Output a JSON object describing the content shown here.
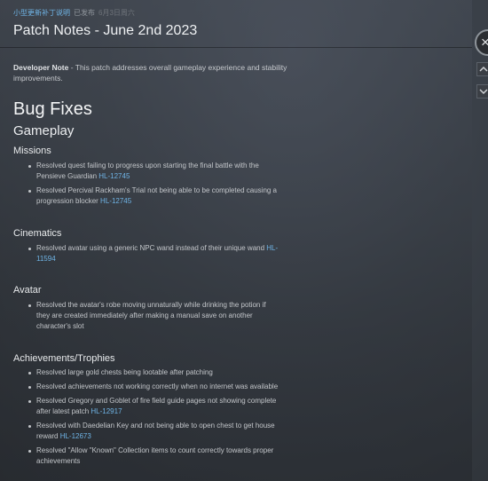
{
  "header": {
    "tag": "小型更新补丁说明",
    "posted": "已发布",
    "date": "6月3日周六",
    "title": "Patch Notes - June 2nd 2023"
  },
  "developer_note": {
    "label": "Developer Note",
    "text": " - This patch addresses overall gameplay experience and stability improvements."
  },
  "bug_fixes_heading": "Bug Fixes",
  "gameplay_heading": "Gameplay",
  "sections": {
    "missions": {
      "heading": "Missions",
      "items": [
        {
          "text": "Resolved quest failing to progress upon starting the final battle with the Pensieve Guardian ",
          "link": "HL-12745"
        },
        {
          "text": "Resolved Percival Rackham's Trial not being able to be completed causing a progression blocker ",
          "link": "HL-12745"
        }
      ]
    },
    "cinematics": {
      "heading": "Cinematics",
      "items": [
        {
          "text": "Resolved avatar using a generic NPC wand instead of their unique wand ",
          "link": "HL-11594"
        }
      ]
    },
    "avatar": {
      "heading": "Avatar",
      "items": [
        {
          "text": "Resolved the avatar's robe moving unnaturally while drinking the potion if they are created immediately after making a manual save on another character's slot",
          "link": ""
        }
      ]
    },
    "achievements": {
      "heading": "Achievements/Trophies",
      "items": [
        {
          "text": "Resolved large gold chests being lootable after patching",
          "link": ""
        },
        {
          "text": "Resolved achievements not working correctly when no internet was available",
          "link": ""
        },
        {
          "text": "Resolved Gregory and Goblet of fire field guide pages not showing complete after latest patch ",
          "link": "HL-12917"
        },
        {
          "text": "Resolved with Daedelian Key and not being able to open chest to get house reward ",
          "link": "HL-12673"
        },
        {
          "text": "Resolved \"Allow \"Known\" Collection items to count correctly towards proper achievements",
          "link": ""
        }
      ]
    }
  },
  "controls": {
    "close_glyph": "×"
  }
}
